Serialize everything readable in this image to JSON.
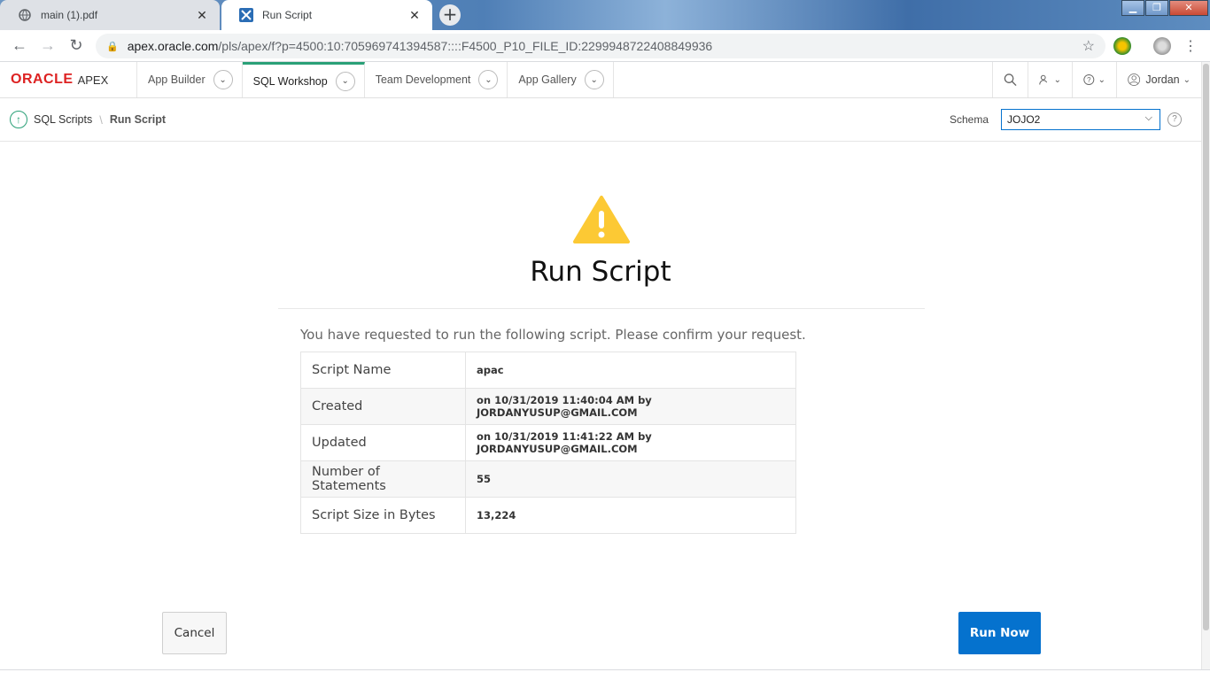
{
  "browser": {
    "tabs": [
      {
        "title": "main (1).pdf",
        "active": false
      },
      {
        "title": "Run Script",
        "active": true
      }
    ],
    "new_tab": "+",
    "address": {
      "host": "apex.oracle.com",
      "path": "/pls/apex/f?p=4500:10:705969741394587::::F4500_P10_FILE_ID:2299948722408849936"
    }
  },
  "header": {
    "logo_brand": "ORACLE",
    "logo_product": "APEX",
    "tabs": [
      {
        "label": "App Builder"
      },
      {
        "label": "SQL Workshop",
        "active": true
      },
      {
        "label": "Team Development"
      },
      {
        "label": "App Gallery"
      }
    ],
    "user_name": "Jordan"
  },
  "breadcrumb": {
    "parent": "SQL Scripts",
    "current": "Run Script"
  },
  "schema": {
    "label": "Schema",
    "value": "JOJO2"
  },
  "dialog": {
    "title": "Run Script",
    "intro": "You have requested to run the following script. Please confirm your request.",
    "rows": [
      {
        "label": "Script Name",
        "value": "apac"
      },
      {
        "label": "Created",
        "value": "on 10/31/2019 11:40:04 AM by JORDANYUSUP@GMAIL.COM"
      },
      {
        "label": "Updated",
        "value": "on 10/31/2019 11:41:22 AM by JORDANYUSUP@GMAIL.COM"
      },
      {
        "label": "Number of Statements",
        "value": "55"
      },
      {
        "label": "Script Size in Bytes",
        "value": "13,224"
      }
    ],
    "cancel_label": "Cancel",
    "run_label": "Run Now"
  },
  "colors": {
    "accent_green": "#2aa077",
    "primary_blue": "#0572ce",
    "warning_yellow": "#fcc934",
    "oracle_red": "#dd2222"
  }
}
